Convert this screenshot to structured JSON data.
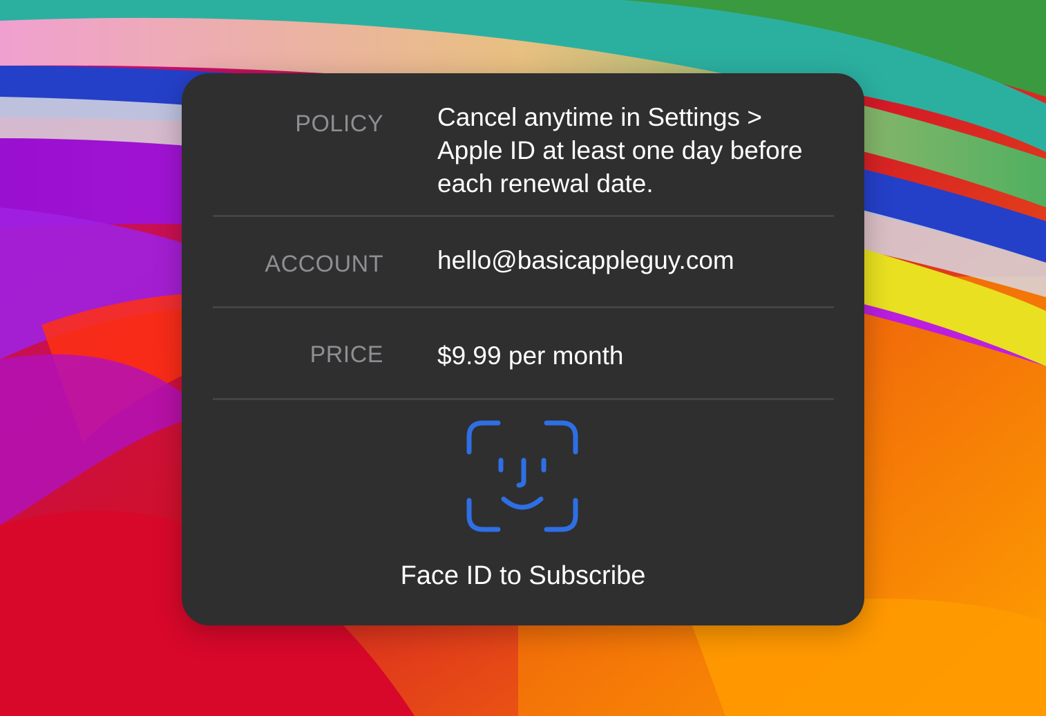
{
  "sheet": {
    "policy": {
      "label": "POLICY",
      "value": "Cancel anytime in Settings > Apple ID at least one day before each renewal date."
    },
    "account": {
      "label": "ACCOUNT",
      "value": "hello@basicappleguy.com"
    },
    "price": {
      "label": "PRICE",
      "value": "$9.99 per month"
    },
    "confirm": {
      "icon": "face-id-icon",
      "label": "Face ID to Subscribe"
    }
  },
  "colors": {
    "sheet_background": "#2f2f30",
    "label_gray": "#8e8e93",
    "value_white": "#ffffff",
    "face_id_blue": "#2f6fe4",
    "divider": "#444446"
  }
}
